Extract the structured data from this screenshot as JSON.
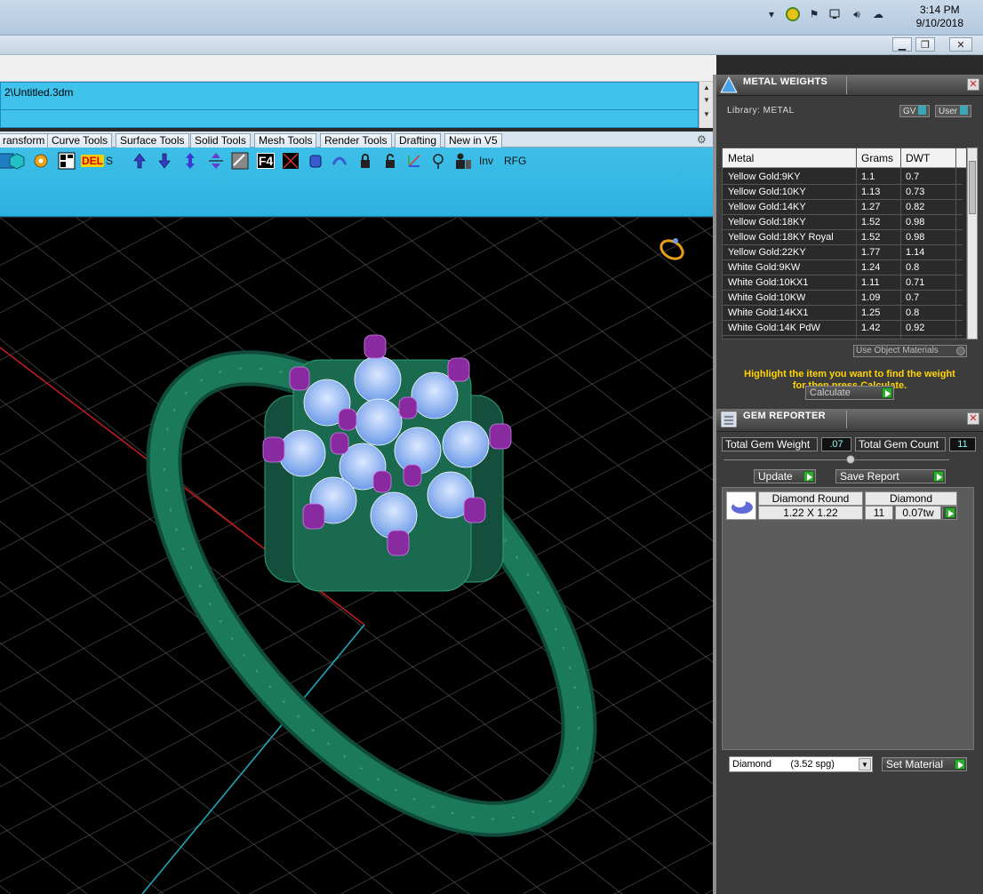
{
  "taskbar": {
    "time": "3:14 PM",
    "date": "9/10/2018",
    "icons": [
      "chevron-up-icon",
      "shield-icon",
      "flag-icon",
      "network-icon",
      "volume-icon",
      "cloud-upload-icon"
    ]
  },
  "window": {
    "minimize_icon": "minimize-icon",
    "restore_icon": "restore-icon",
    "close_icon": "close-icon"
  },
  "command": {
    "line1": "2\\Untitled.3dm"
  },
  "tabs": [
    "ransform",
    "Curve Tools",
    "Surface Tools",
    "Solid Tools",
    "Mesh Tools",
    "Render Tools",
    "Drafting",
    "New in V5"
  ],
  "toolbar": {
    "s_label": "S",
    "inv_label": "Inv",
    "rfg_label": "RFG",
    "del_label": "DEL",
    "f4_label": "F4"
  },
  "metal_weights": {
    "title": "METAL WEIGHTS",
    "library_label": "Library: METAL",
    "gv_label": "GV",
    "user_label": "User",
    "columns": [
      "Metal",
      "Grams",
      "DWT"
    ],
    "rows": [
      [
        "Yellow Gold:9KY",
        "1.1",
        "0.7"
      ],
      [
        "Yellow Gold:10KY",
        "1.13",
        "0.73"
      ],
      [
        "Yellow Gold:14KY",
        "1.27",
        "0.82"
      ],
      [
        "Yellow Gold:18KY",
        "1.52",
        "0.98"
      ],
      [
        "Yellow Gold:18KY Royal",
        "1.52",
        "0.98"
      ],
      [
        "Yellow Gold:22KY",
        "1.77",
        "1.14"
      ],
      [
        "White Gold:9KW",
        "1.24",
        "0.8"
      ],
      [
        "White Gold:10KX1",
        "1.11",
        "0.71"
      ],
      [
        "White Gold:10KW",
        "1.09",
        "0.7"
      ],
      [
        "White Gold:14KX1",
        "1.25",
        "0.8"
      ],
      [
        "White Gold:14K PdW",
        "1.42",
        "0.92"
      ]
    ],
    "use_object_materials": "Use Object Materials",
    "hint_line1": "Highlight the item you want to find the weight",
    "hint_line2": "for then press Calculate.",
    "calculate_label": "Calculate"
  },
  "gem_reporter": {
    "title": "GEM REPORTER",
    "total_weight_label": "Total Gem Weight",
    "total_weight_value": ".07",
    "total_count_label": "Total Gem Count",
    "total_count_value": "11",
    "update_label": "Update",
    "save_report_label": "Save Report",
    "gem": {
      "shape": "Diamond Round",
      "size": "1.22 X 1.22",
      "material": "Diamond",
      "count": "11",
      "weight": "0.07tw"
    },
    "material_select": "Diamond       (3.52 spg)",
    "set_material_label": "Set Material"
  },
  "colors": {
    "toolbar_blue": "#3ebfe8",
    "ring_green": "#1a7a5a",
    "gem_blue": "#8fb8f8",
    "prong_purple": "#8a2aa0",
    "hint_yellow": "#ffd400"
  }
}
